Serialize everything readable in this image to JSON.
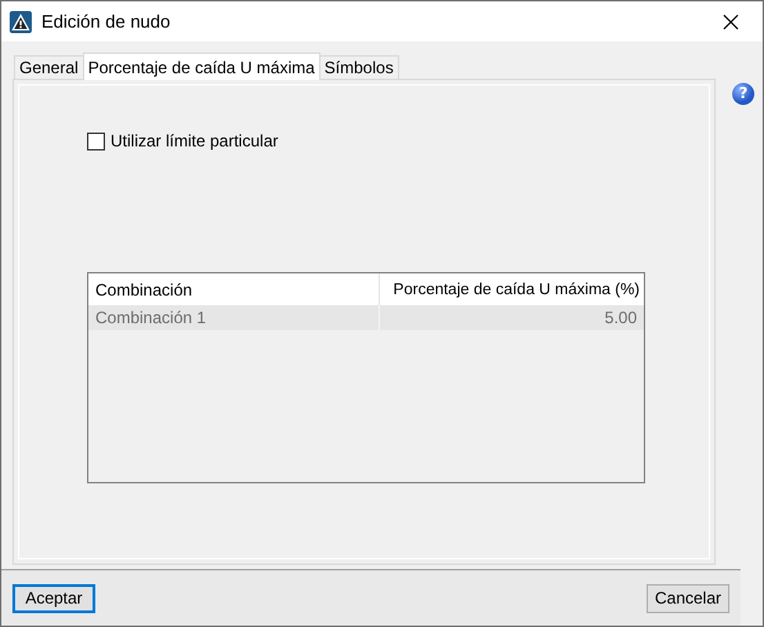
{
  "window": {
    "title": "Edición de nudo"
  },
  "tabs": [
    {
      "label": "General",
      "selected": false
    },
    {
      "label": "Porcentaje de caída U máxima",
      "selected": true
    },
    {
      "label": "Símbolos",
      "selected": false
    }
  ],
  "checkbox": {
    "label": "Utilizar límite particular",
    "checked": false
  },
  "table": {
    "columns": [
      "Combinación",
      "Porcentaje de caída U máxima (%)"
    ],
    "rows": [
      {
        "cells": [
          "Combinación 1",
          "5.00"
        ],
        "disabled": true
      }
    ]
  },
  "help": {
    "label": "?"
  },
  "buttons": [
    {
      "label": "Aceptar",
      "default": true
    },
    {
      "label": "Cancelar",
      "default": false
    }
  ]
}
